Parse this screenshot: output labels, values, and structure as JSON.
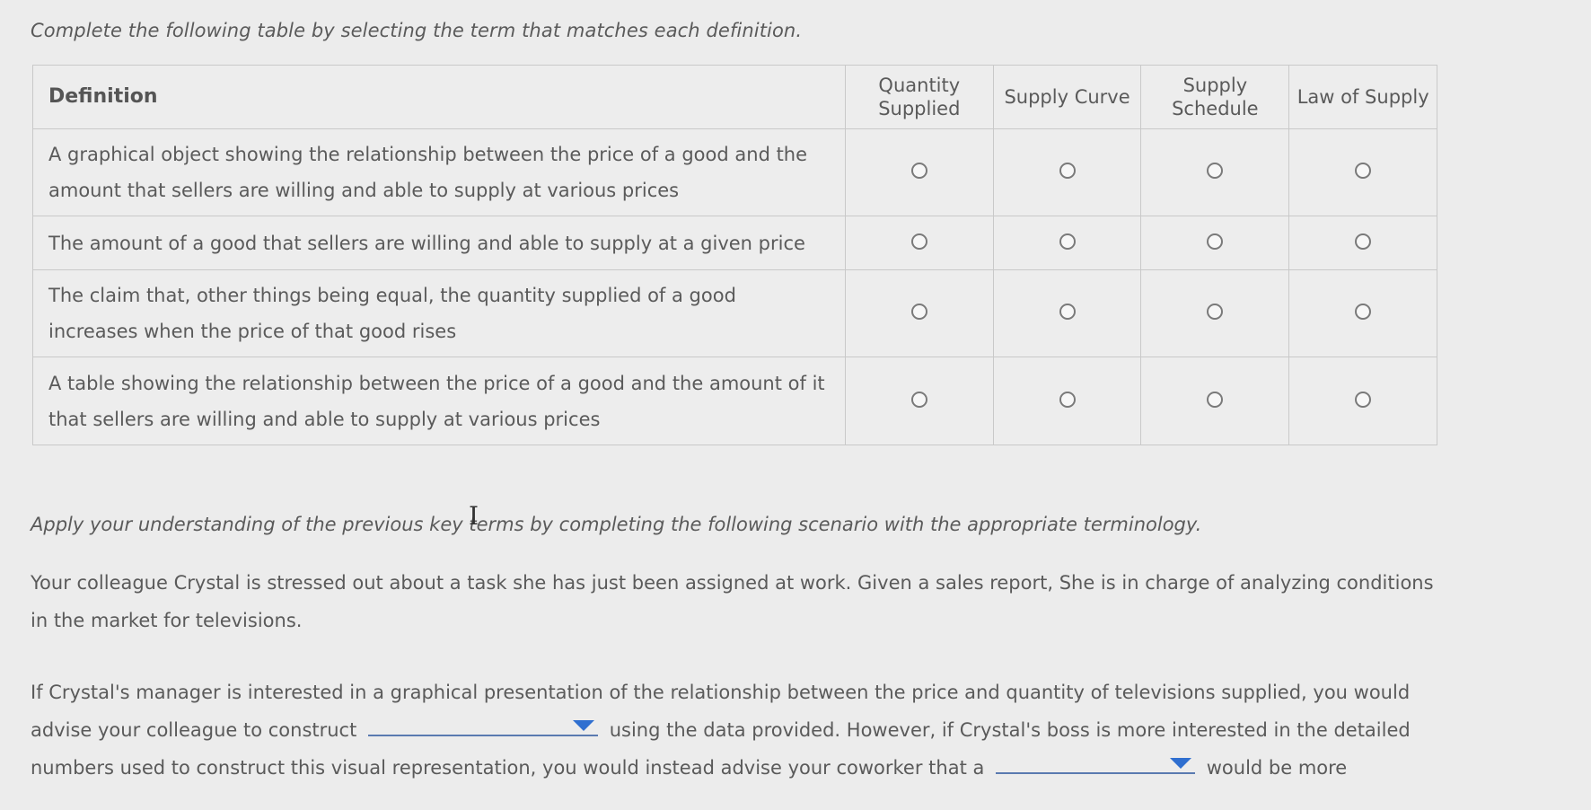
{
  "instructions": "Complete the following table by selecting the term that matches each definition.",
  "table": {
    "definition_header": "Definition",
    "options": [
      "Quantity Supplied",
      "Supply Curve",
      "Supply Schedule",
      "Law of Supply"
    ],
    "rows": [
      {
        "definition": "A graphical object showing the relationship between the price of a good and the amount that sellers are willing and able to supply at various prices"
      },
      {
        "definition": "The amount of a good that sellers are willing and able to supply at a given price"
      },
      {
        "definition": "The claim that, other things being equal, the quantity supplied of a good increases when the price of that good rises"
      },
      {
        "definition": "A table showing the relationship between the price of a good and the amount of it that sellers are willing and able to supply at various prices"
      }
    ]
  },
  "scenario": {
    "intro": "Apply your understanding of the previous key terms by completing the following scenario with the appropriate terminology.",
    "paragraph1": "Your colleague Crystal is stressed out about a task she has just been assigned at work. Given a sales report, She is in charge of analyzing conditions in the market for televisions.",
    "paragraph2_part1": "If Crystal's manager is interested in a graphical presentation of the relationship between the price and quantity of televisions supplied, you would advise your colleague to construct",
    "paragraph2_part2": "using the data provided. However, if Crystal's boss is more interested in the detailed numbers used to construct this visual representation, you would instead advise your coworker that a",
    "paragraph2_part3": "would be more",
    "dropdown1_value": "",
    "dropdown2_value": ""
  },
  "icons": {
    "cursor": "text-cursor-icon",
    "dropdown": "dropdown-arrow-icon",
    "radio": "radio-button-icon"
  }
}
